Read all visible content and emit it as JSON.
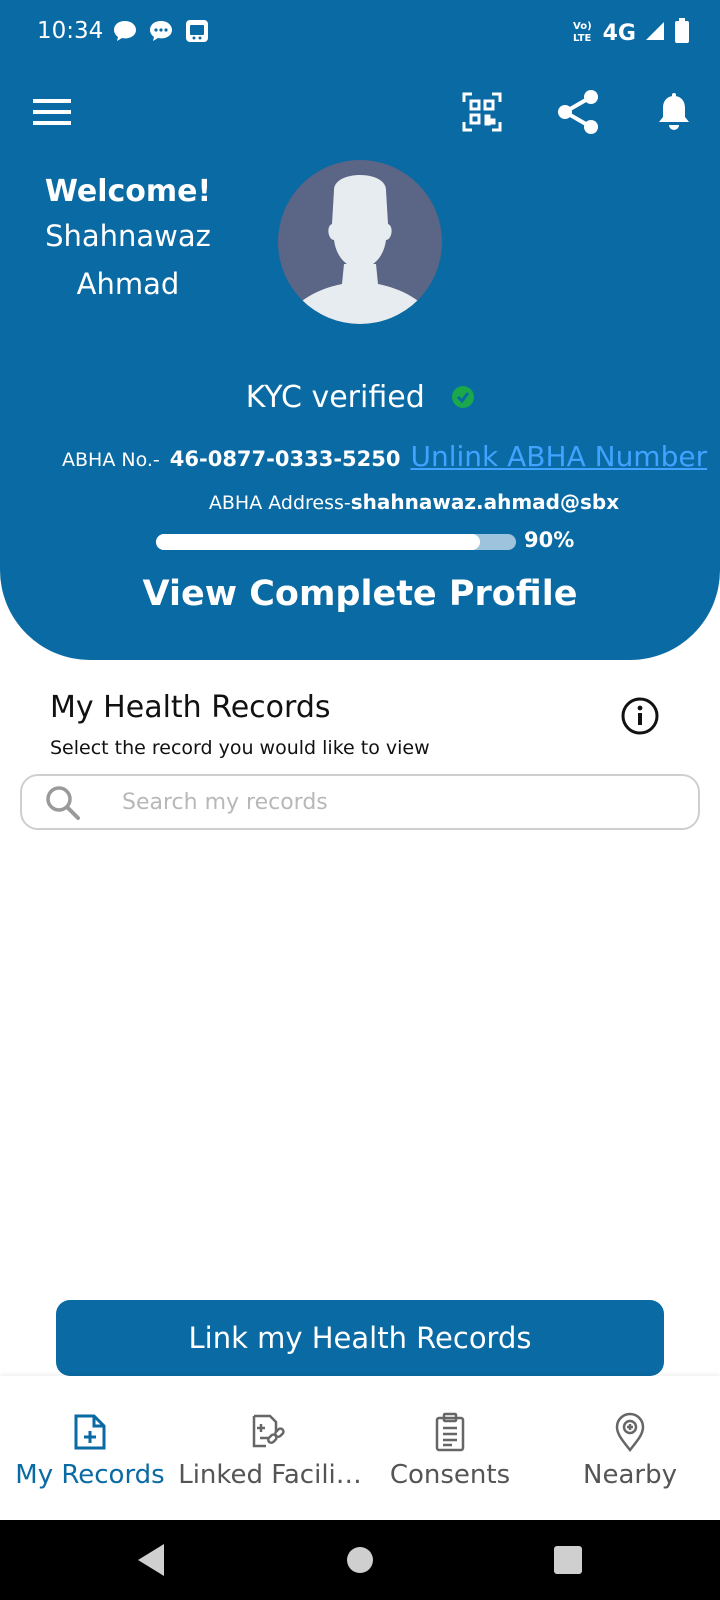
{
  "status_bar": {
    "time": "10:34",
    "network": "4G",
    "volte": "Vo LTE"
  },
  "toolbar": {
    "menu_icon": "hamburger-menu-icon",
    "qr_icon": "qr-code-icon",
    "share_icon": "share-icon",
    "bell_icon": "notification-bell-icon"
  },
  "profile": {
    "welcome": "Welcome!",
    "first_name": "Shahnawaz",
    "last_name": "Ahmad",
    "kyc_status": "KYC verified",
    "abha_no_label": "ABHA No.-",
    "abha_no_value": "46-0877-0333-5250",
    "unlink_label": "Unlink ABHA Number",
    "abha_address_label": "ABHA Address-",
    "abha_address_value": "shahnawaz.ahmad@sbx",
    "completion_percent": 90,
    "completion_text": "90%",
    "view_profile_label": "View Complete Profile"
  },
  "records": {
    "title": "My Health Records",
    "subtitle": "Select the record you would like to view",
    "search_placeholder": "Search my records",
    "search_value": ""
  },
  "link_button_label": "Link my Health Records",
  "bottom_nav": {
    "items": [
      {
        "label": "My Records",
        "icon": "records-icon",
        "active": true
      },
      {
        "label": "Linked Facili…",
        "icon": "linked-facilities-icon",
        "active": false
      },
      {
        "label": "Consents",
        "icon": "consents-clipboard-icon",
        "active": false
      },
      {
        "label": "Nearby",
        "icon": "nearby-location-icon",
        "active": false
      }
    ]
  },
  "colors": {
    "primary": "#0a6aa3",
    "link": "#3fa3ff",
    "verified": "#1aa84a"
  }
}
